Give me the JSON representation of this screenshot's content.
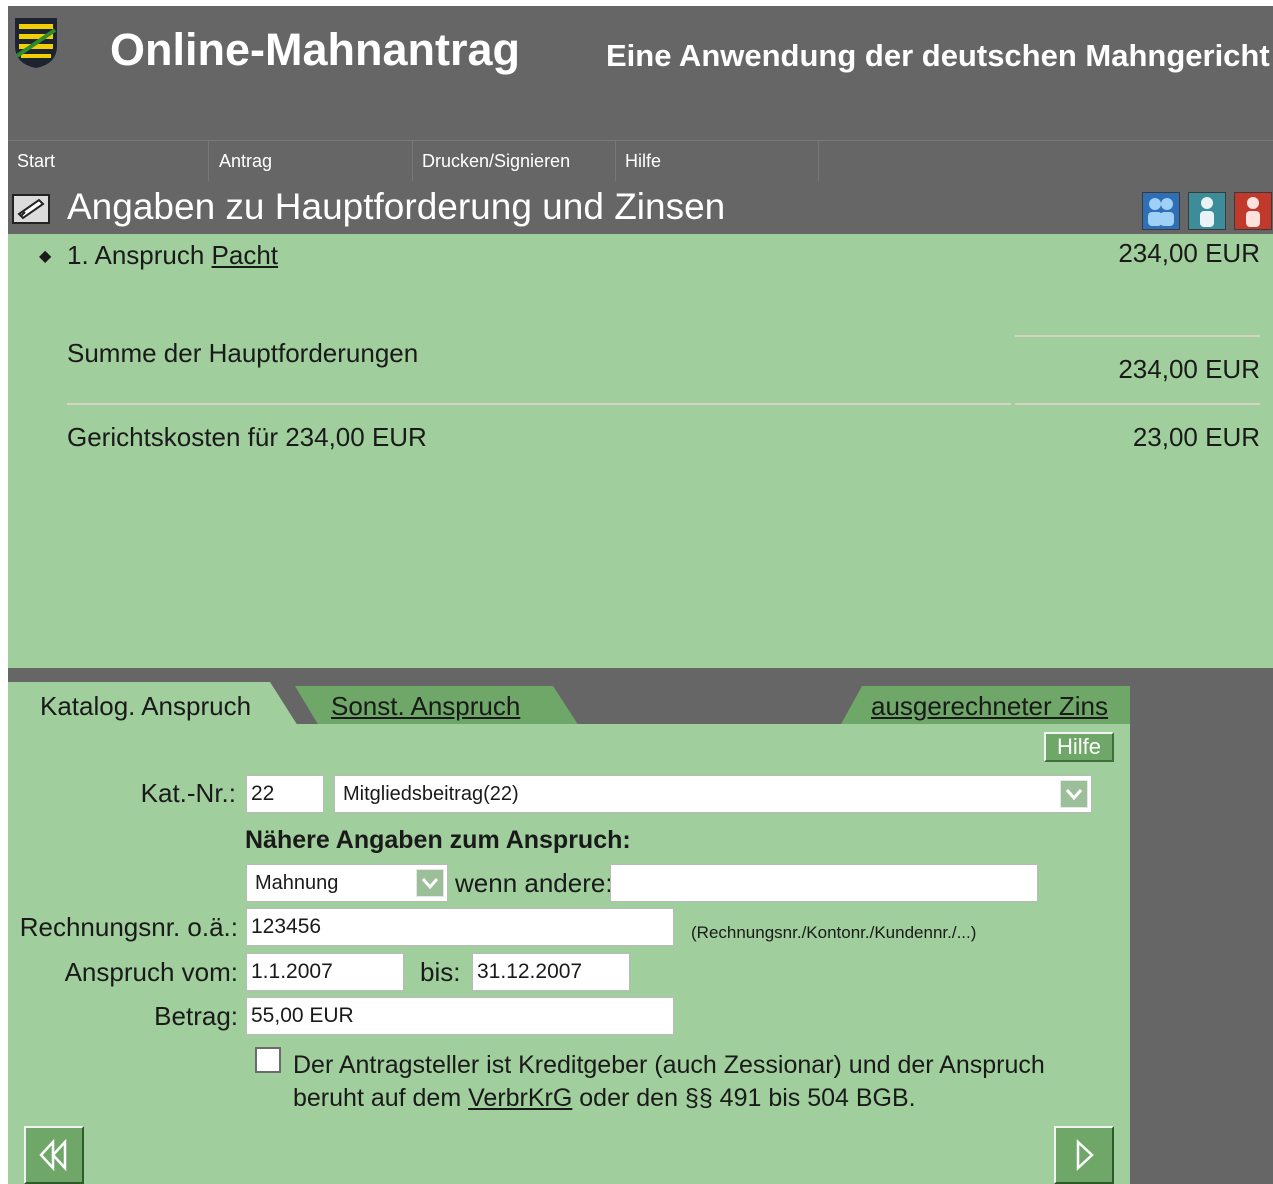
{
  "header": {
    "title": "Online-Mahnantrag",
    "subtitle": "Eine Anwendung der deutschen Mahngericht"
  },
  "nav": {
    "items": [
      {
        "label": "Start"
      },
      {
        "label": "Antrag"
      },
      {
        "label": "Drucken/Signieren"
      },
      {
        "label": "Hilfe"
      }
    ]
  },
  "page": {
    "title": "Angaben zu Hauptforderung und Zinsen",
    "icon": "edit-form-icon",
    "user_icons": [
      "users-icon",
      "user-icon",
      "user-red-icon"
    ]
  },
  "summary": {
    "claim_prefix": "1. Anspruch",
    "claim_link": "Pacht",
    "claim_amount": "234,00 EUR",
    "sum_label": "Summe der Hauptforderungen",
    "sum_amount": "234,00 EUR",
    "costs_label": "Gerichtskosten für 234,00 EUR",
    "costs_amount": "23,00 EUR"
  },
  "tabs": {
    "active": "Katalog. Anspruch",
    "other": "Sonst. Anspruch",
    "interest": "ausgerechneter Zins"
  },
  "form": {
    "help_label": "Hilfe",
    "katnr_label": "Kat.-Nr.:",
    "katnr_value": "22",
    "katalog_select": "Mitgliedsbeitrag(22)",
    "details_heading": "Nähere Angaben zum Anspruch:",
    "details_select": "Mahnung",
    "other_label": "wenn andere:",
    "other_value": "",
    "invoice_label": "Rechnungsnr. o.ä.:",
    "invoice_value": "123456",
    "invoice_hint": "(Rechnungsnr./Kontonr./Kundennr./...)",
    "from_label": "Anspruch vom:",
    "from_value": "1.1.2007",
    "to_label": "bis:",
    "to_value": "31.12.2007",
    "amount_label": "Betrag:",
    "amount_value": "55,00 EUR",
    "checkbox_text_1": "Der Antragsteller ist Kreditgeber (auch Zessionar) und der Anspruch beruht auf dem ",
    "checkbox_link": "VerbrKrG",
    "checkbox_text_2": " oder den §§ 491 bis 504 BGB.",
    "checkbox_checked": false
  },
  "buttons": {
    "back": "rewind-icon",
    "next": "play-icon"
  },
  "colors": {
    "background": "#666666",
    "panel": "#a0ce9d",
    "tab_inactive": "#6fa768"
  }
}
